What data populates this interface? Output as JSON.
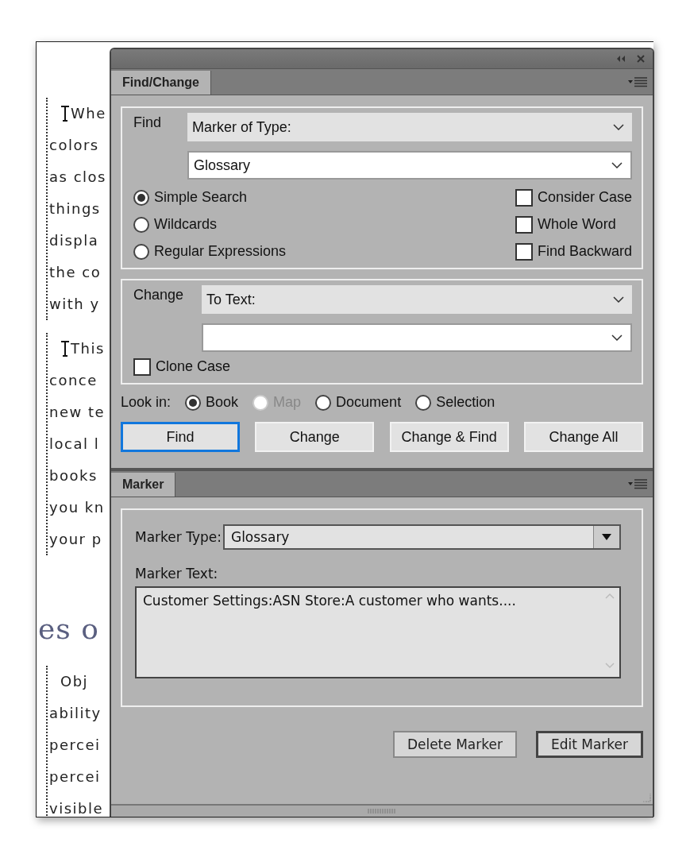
{
  "document": {
    "blocks": [
      {
        "kind": "text",
        "lines": [
          {
            "text": "Whe",
            "first": true
          },
          {
            "text": "colors",
            "first": false
          },
          {
            "text": "as clos",
            "first": false
          },
          {
            "text": "things",
            "first": false
          },
          {
            "text": "displa",
            "first": false
          },
          {
            "text": "the co",
            "first": false
          },
          {
            "text": "with y",
            "first": false
          }
        ]
      },
      {
        "kind": "text",
        "lines": [
          {
            "text": "This",
            "first": true
          },
          {
            "text": "conce",
            "first": false
          },
          {
            "text": "new te",
            "first": false
          },
          {
            "text": "local l",
            "first": false
          },
          {
            "text": "books",
            "first": false
          },
          {
            "text": "you kn",
            "first": false
          },
          {
            "text": "your p",
            "first": false
          }
        ]
      },
      {
        "kind": "heading",
        "text": "es o"
      },
      {
        "kind": "text",
        "lines": [
          {
            "text": "Obj",
            "first": true
          },
          {
            "text": "ability",
            "first": false
          },
          {
            "text": "percei",
            "first": false
          },
          {
            "text": "percei",
            "first": false
          },
          {
            "text": "visible",
            "first": false
          }
        ]
      }
    ]
  },
  "find_change": {
    "tab": {
      "label": "Find/Change",
      "selected": true
    },
    "find": {
      "label": "Find",
      "type": "Marker of Type:",
      "value": "Glossary",
      "modes": [
        {
          "label": "Simple Search",
          "selected": true
        },
        {
          "label": "Wildcards",
          "selected": false
        },
        {
          "label": "Regular Expressions",
          "selected": false
        }
      ],
      "options": [
        {
          "label": "Consider Case",
          "checked": false
        },
        {
          "label": "Whole Word",
          "checked": false
        },
        {
          "label": "Find Backward",
          "checked": false
        }
      ]
    },
    "change": {
      "label": "Change",
      "type": "To Text:",
      "clone_case": {
        "label": "Clone Case",
        "checked": false
      }
    },
    "look_in": {
      "label": "Look in:",
      "options": [
        {
          "label": "Book",
          "selected": true,
          "disabled": false
        },
        {
          "label": "Map",
          "selected": false,
          "disabled": true
        },
        {
          "label": "Document",
          "selected": false,
          "disabled": false
        },
        {
          "label": "Selection",
          "selected": false,
          "disabled": false
        }
      ]
    },
    "buttons": [
      {
        "label": "Find",
        "focused": true
      },
      {
        "label": "Change",
        "focused": false
      },
      {
        "label": "Change & Find",
        "focused": false
      },
      {
        "label": "Change All",
        "focused": false
      }
    ]
  },
  "marker": {
    "tab": {
      "label": "Marker",
      "selected": true
    },
    "type_label": "Marker Type:",
    "type": "Glossary",
    "text_label": "Marker Text:",
    "text": "Customer Settings:ASN Store:A customer who wants....",
    "buttons": [
      {
        "label": "Delete Marker",
        "default": false
      },
      {
        "label": "Edit Marker",
        "default": true
      }
    ]
  }
}
